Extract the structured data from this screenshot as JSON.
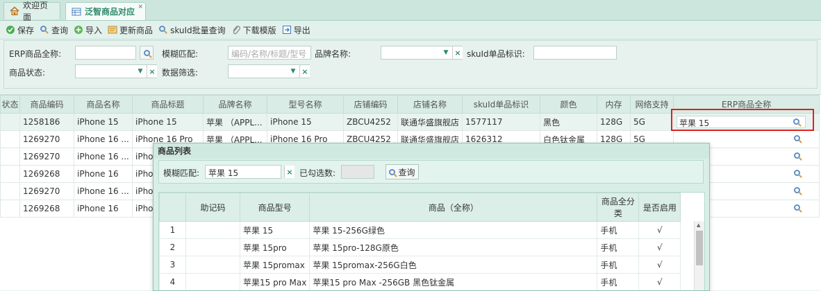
{
  "tabs": [
    {
      "label": "欢迎页面"
    },
    {
      "label": "泛智商品对应",
      "close": "×"
    }
  ],
  "toolbar": {
    "save": "保存",
    "query": "查询",
    "import": "导入",
    "update": "更新商品",
    "skuid_batch": "skuId批量查询",
    "download_template": "下载模版",
    "export": "导出"
  },
  "filters": {
    "erp_name_label": "ERP商品全称:",
    "fuzzy_label": "模糊匹配:",
    "fuzzy_placeholder": "编码/名称/标题/型号",
    "brand_label": "品牌名称:",
    "skuid_label": "skuId单品标识:",
    "status_label": "商品状态:",
    "datafilter_label": "数据筛选:"
  },
  "grid": {
    "columns": [
      "状态",
      "商品编码",
      "商品名称",
      "商品标题",
      "品牌名称",
      "型号名称",
      "店铺编码",
      "店铺名称",
      "skuId单品标识",
      "颜色",
      "内存",
      "网络支持",
      "ERP商品全称"
    ],
    "rows": [
      {
        "code": "1258186",
        "name": "iPhone 15",
        "title": "iPhone 15",
        "brand": "苹果 （APPL...",
        "model": "iPhone 15",
        "shop_code": "ZBCU4252",
        "shop_name": "联通华盛旗舰店",
        "skuid": "1577117",
        "color": "黑色",
        "memory": "128G",
        "network": "5G",
        "erp": "苹果 15"
      },
      {
        "code": "1269270",
        "name": "iPhone 16 ...",
        "title": "iPhone 16 Pro",
        "brand": "苹果 （APPL...",
        "model": "iPhone 16 Pro",
        "shop_code": "ZBCU4252",
        "shop_name": "联通华盛旗舰店",
        "skuid": "1626312",
        "color": "白色钛金属",
        "memory": "128G",
        "network": "5G",
        "erp": ""
      },
      {
        "code": "1269270",
        "name": "iPhone 16 ...",
        "title": "iPho",
        "brand": "",
        "model": "",
        "shop_code": "",
        "shop_name": "",
        "skuid": "",
        "color": "",
        "memory": "",
        "network": "",
        "erp": ""
      },
      {
        "code": "1269268",
        "name": "iPhone 16",
        "title": "iPho",
        "brand": "",
        "model": "",
        "shop_code": "",
        "shop_name": "",
        "skuid": "",
        "color": "",
        "memory": "",
        "network": "",
        "erp": ""
      },
      {
        "code": "1269270",
        "name": "iPhone 16 ...",
        "title": "iPho",
        "brand": "",
        "model": "",
        "shop_code": "",
        "shop_name": "",
        "skuid": "",
        "color": "",
        "memory": "",
        "network": "",
        "erp": ""
      },
      {
        "code": "1269268",
        "name": "iPhone 16",
        "title": "iPho",
        "brand": "",
        "model": "",
        "shop_code": "",
        "shop_name": "",
        "skuid": "",
        "color": "",
        "memory": "",
        "network": "",
        "erp": ""
      }
    ]
  },
  "popup": {
    "title": "商品列表",
    "fuzzy_label": "模糊匹配:",
    "fuzzy_value": "苹果 15",
    "checked_label": "已勾选数:",
    "query_button": "查询",
    "columns": [
      "",
      "助记码",
      "商品型号",
      "商品（全称）",
      "商品全分类",
      "是否启用"
    ],
    "rows": [
      {
        "no": "1",
        "mnemonic": "",
        "model": "苹果 15",
        "fullname": "苹果 15-256G绿色",
        "category": "手机",
        "enabled": "√"
      },
      {
        "no": "2",
        "mnemonic": "",
        "model": "苹果 15pro",
        "fullname": "苹果 15pro-128G原色",
        "category": "手机",
        "enabled": "√"
      },
      {
        "no": "3",
        "mnemonic": "",
        "model": "苹果 15promax",
        "fullname": "苹果 15promax-256G白色",
        "category": "手机",
        "enabled": "√"
      },
      {
        "no": "4",
        "mnemonic": "",
        "model": "苹果15 pro Max",
        "fullname": "苹果15 pro Max -256GB 黑色钛金属",
        "category": "手机",
        "enabled": "√"
      }
    ]
  },
  "colors": {
    "accent": "#2e8a6a",
    "highlight_border": "#e02020",
    "check": "#2aa52a"
  }
}
